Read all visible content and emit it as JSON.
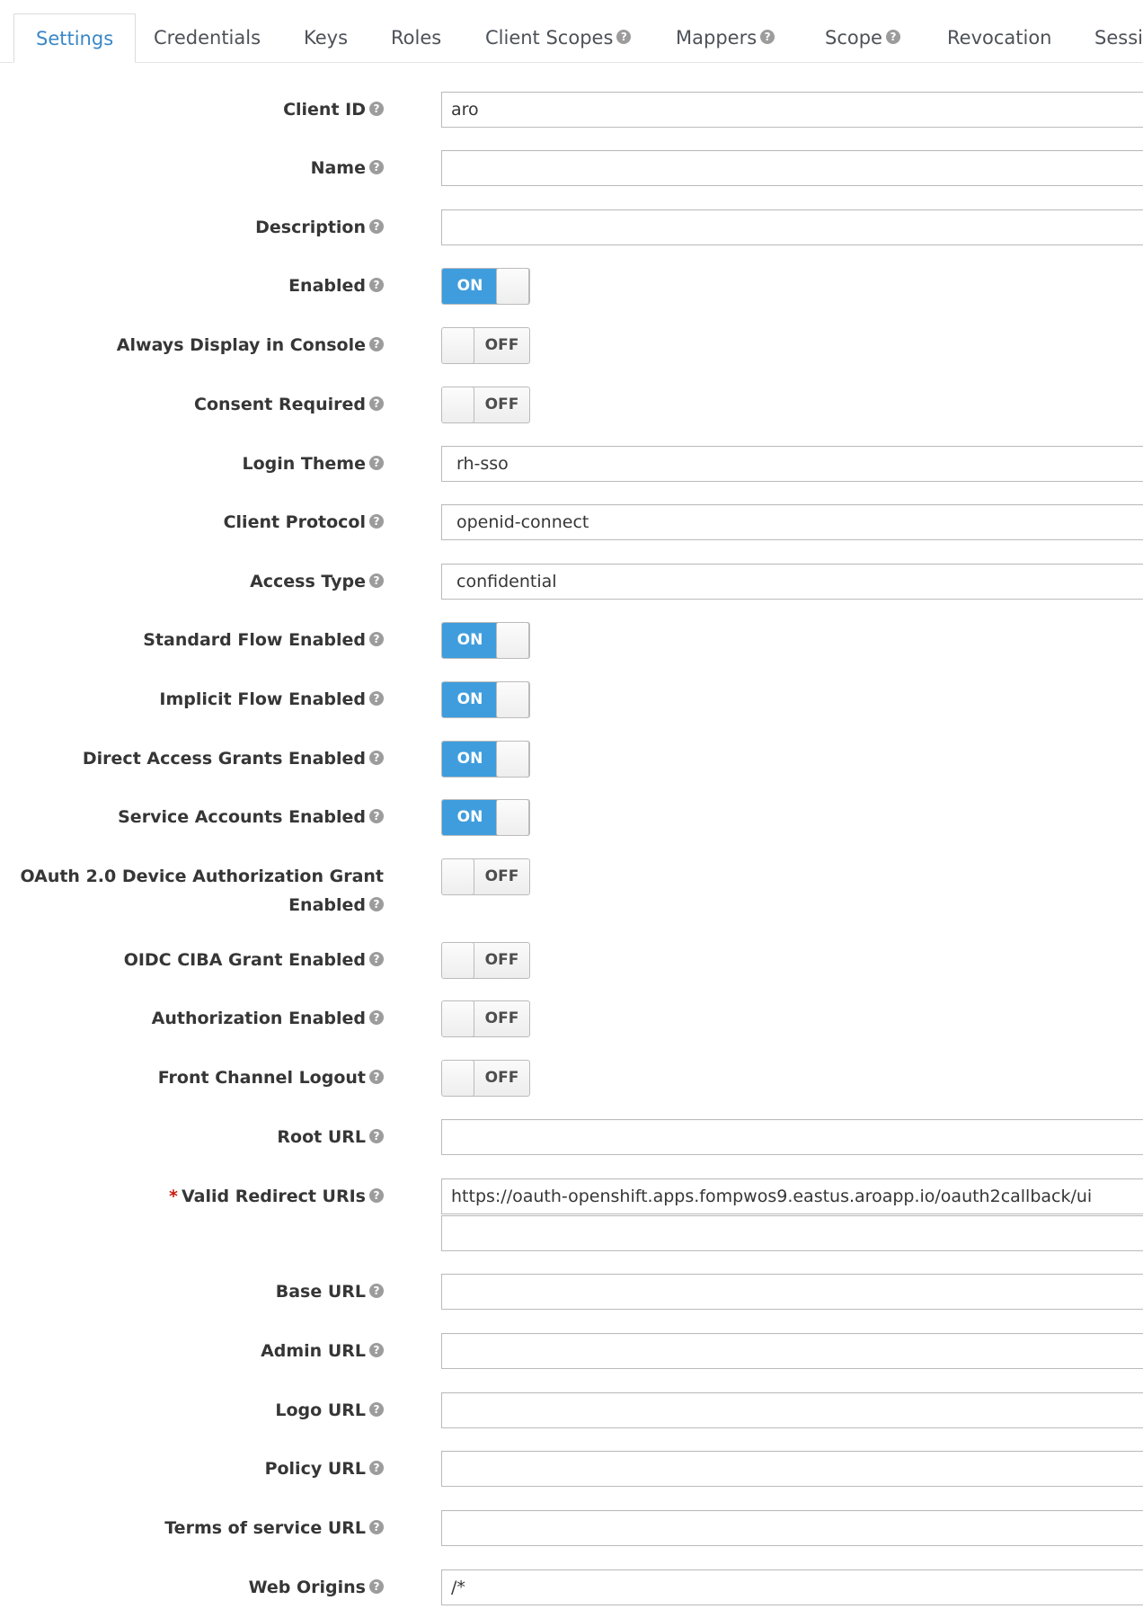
{
  "tabs": [
    {
      "label": "Settings",
      "active": true,
      "help": false
    },
    {
      "label": "Credentials",
      "help": false
    },
    {
      "label": "Keys",
      "help": false
    },
    {
      "label": "Roles",
      "help": false
    },
    {
      "label": "Client Scopes",
      "help": true
    },
    {
      "label": "Mappers",
      "help": true
    },
    {
      "label": "Scope",
      "help": true
    },
    {
      "label": "Revocation",
      "help": false
    },
    {
      "label": "Sessions",
      "help": false
    }
  ],
  "help_icon": "question-circle-icon",
  "fields": {
    "client_id": {
      "label": "Client ID",
      "value": "aro"
    },
    "name": {
      "label": "Name",
      "value": ""
    },
    "description": {
      "label": "Description",
      "value": ""
    },
    "enabled": {
      "label": "Enabled",
      "state": "ON"
    },
    "always_display": {
      "label": "Always Display in Console",
      "state": "OFF"
    },
    "consent_required": {
      "label": "Consent Required",
      "state": "OFF"
    },
    "login_theme": {
      "label": "Login Theme",
      "value": "rh-sso"
    },
    "client_protocol": {
      "label": "Client Protocol",
      "value": "openid-connect"
    },
    "access_type": {
      "label": "Access Type",
      "value": "confidential"
    },
    "standard_flow": {
      "label": "Standard Flow Enabled",
      "state": "ON"
    },
    "implicit_flow": {
      "label": "Implicit Flow Enabled",
      "state": "ON"
    },
    "direct_access": {
      "label": "Direct Access Grants Enabled",
      "state": "ON"
    },
    "service_accounts": {
      "label": "Service Accounts Enabled",
      "state": "ON"
    },
    "oauth_device": {
      "label_line1": "OAuth 2.0 Device Authorization Grant",
      "label_line2": "Enabled",
      "state": "OFF"
    },
    "oidc_ciba": {
      "label": "OIDC CIBA Grant Enabled",
      "state": "OFF"
    },
    "authorization": {
      "label": "Authorization Enabled",
      "state": "OFF"
    },
    "front_channel": {
      "label": "Front Channel Logout",
      "state": "OFF"
    },
    "root_url": {
      "label": "Root URL",
      "value": ""
    },
    "valid_redirect": {
      "required_mark": "*",
      "label": "Valid Redirect URIs",
      "values": [
        "https://oauth-openshift.apps.fompwos9.eastus.aroapp.io/oauth2callback/ui",
        ""
      ]
    },
    "base_url": {
      "label": "Base URL",
      "value": ""
    },
    "admin_url": {
      "label": "Admin URL",
      "value": ""
    },
    "logo_url": {
      "label": "Logo URL",
      "value": ""
    },
    "policy_url": {
      "label": "Policy URL",
      "value": ""
    },
    "tos_url": {
      "label": "Terms of service URL",
      "value": ""
    },
    "web_origins": {
      "label": "Web Origins",
      "value": "/*"
    }
  },
  "toggle_text": {
    "on": "ON",
    "off": "OFF"
  },
  "colors": {
    "accent": "#3a87c8",
    "toggle_on": "#3f9ddd",
    "required": "#c9190b"
  }
}
